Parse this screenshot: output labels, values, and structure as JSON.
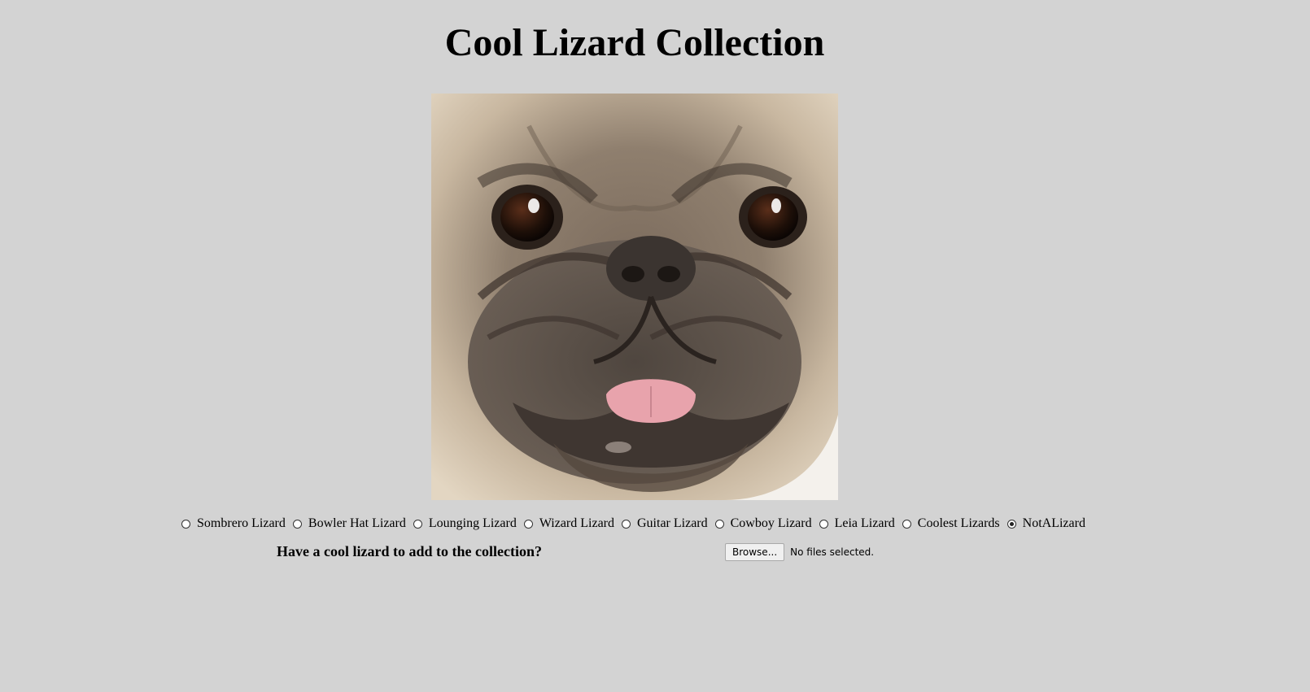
{
  "page": {
    "title": "Cool Lizard Collection",
    "background_color": "#d3d3d3"
  },
  "gallery": {
    "image_icon": "pug-face-photo"
  },
  "options": [
    {
      "label": "Sombrero Lizard",
      "checked": false
    },
    {
      "label": "Bowler Hat Lizard",
      "checked": false
    },
    {
      "label": "Lounging Lizard",
      "checked": false
    },
    {
      "label": "Wizard Lizard",
      "checked": false
    },
    {
      "label": "Guitar Lizard",
      "checked": false
    },
    {
      "label": "Cowboy Lizard",
      "checked": false
    },
    {
      "label": "Leia Lizard",
      "checked": false
    },
    {
      "label": "Coolest Lizards",
      "checked": false
    },
    {
      "label": "NotALizard",
      "checked": true
    }
  ],
  "upload": {
    "prompt": "Have a cool lizard to add to the collection?",
    "browse_label": "Browse...",
    "status": "No files selected."
  }
}
